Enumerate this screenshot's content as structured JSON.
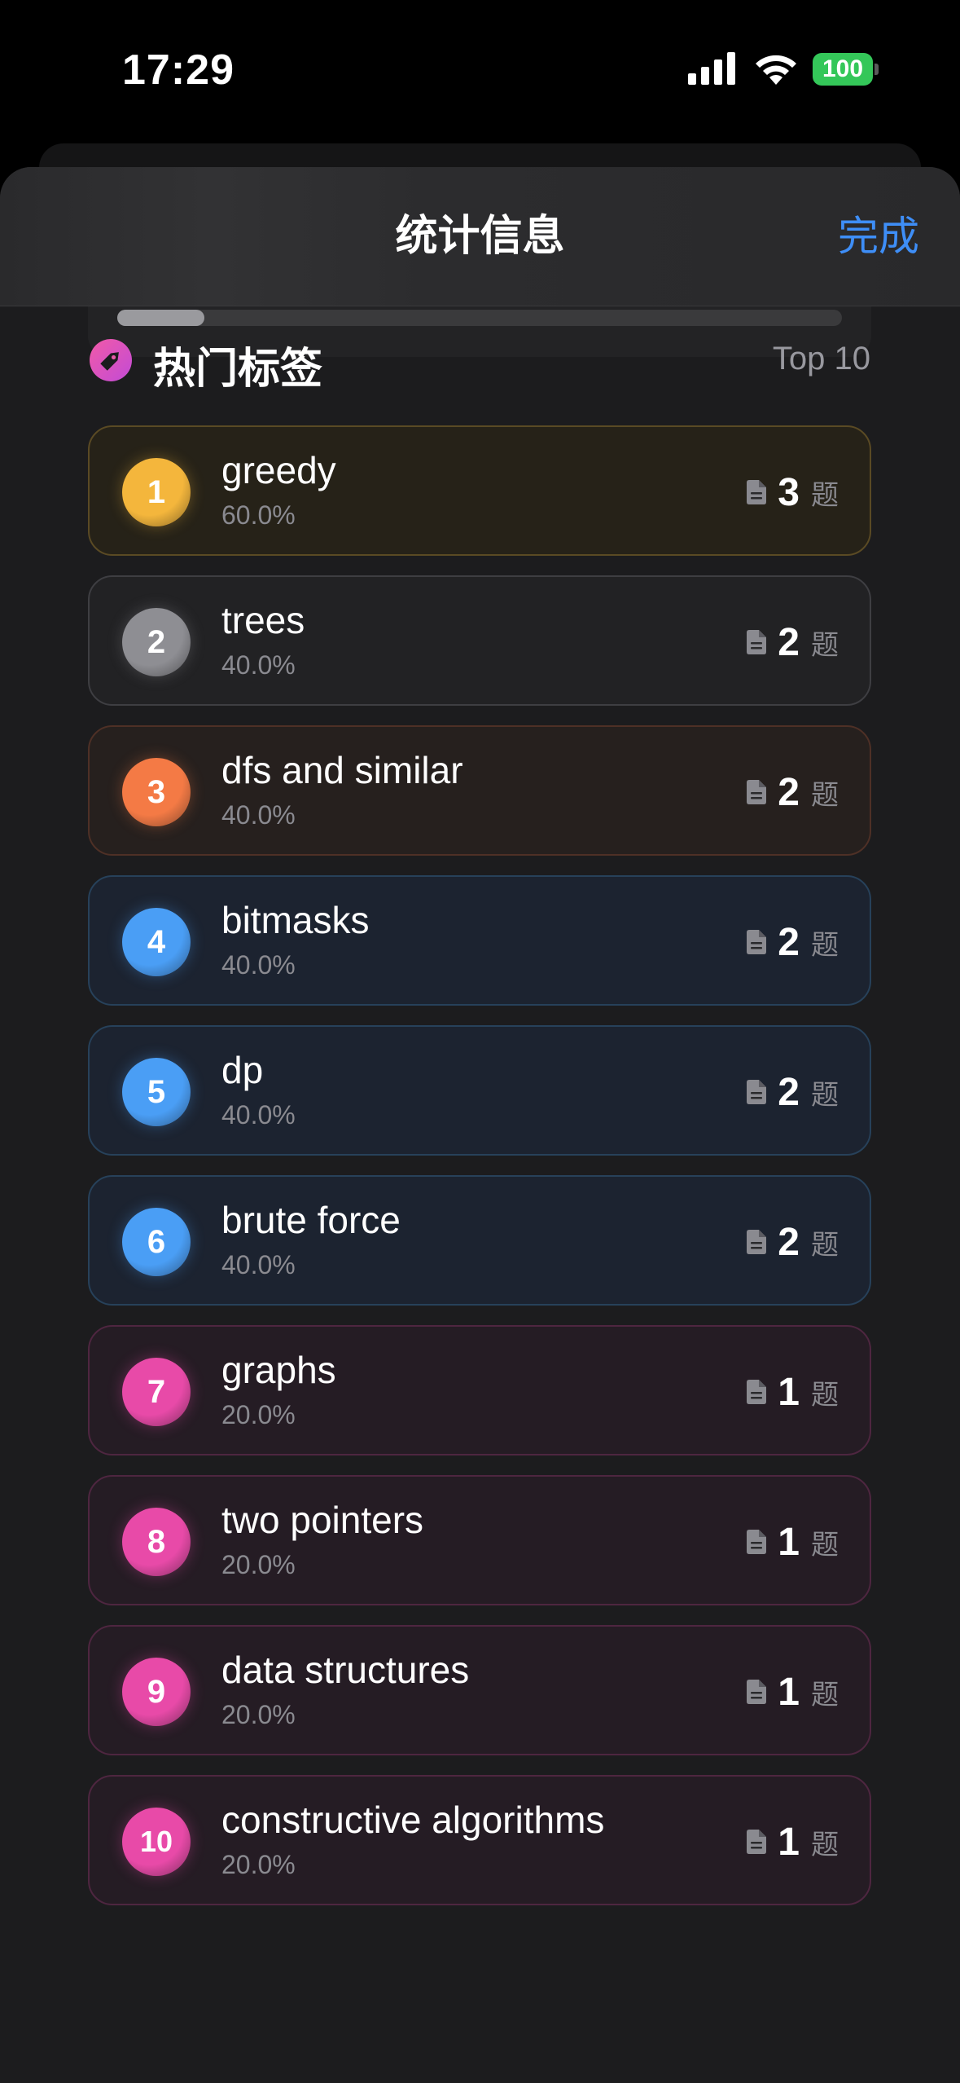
{
  "status_bar": {
    "time": "17:29",
    "battery": "100"
  },
  "nav": {
    "title": "统计信息",
    "done_label": "完成"
  },
  "progress": {
    "fraction": 0.12
  },
  "section": {
    "title": "热门标签",
    "top_label": "Top 10",
    "icon": "tag-icon"
  },
  "count_unit": "题",
  "tags": [
    {
      "rank": "1",
      "name": "greedy",
      "percent": "60.0%",
      "count": "3",
      "color": "#f4b63c",
      "border": "#5a4a24",
      "bg": "#262218"
    },
    {
      "rank": "2",
      "name": "trees",
      "percent": "40.0%",
      "count": "2",
      "color": "#8e8e93",
      "border": "#3e3e42",
      "bg": "#222224"
    },
    {
      "rank": "3",
      "name": "dfs and similar",
      "percent": "40.0%",
      "count": "2",
      "color": "#f47a45",
      "border": "#4e3026",
      "bg": "#26201e"
    },
    {
      "rank": "4",
      "name": "bitmasks",
      "percent": "40.0%",
      "count": "2",
      "color": "#4a9ef5",
      "border": "#27415a",
      "bg": "#1c2330"
    },
    {
      "rank": "5",
      "name": "dp",
      "percent": "40.0%",
      "count": "2",
      "color": "#4a9ef5",
      "border": "#27415a",
      "bg": "#1c2330"
    },
    {
      "rank": "6",
      "name": "brute force",
      "percent": "40.0%",
      "count": "2",
      "color": "#4a9ef5",
      "border": "#27415a",
      "bg": "#1c2330"
    },
    {
      "rank": "7",
      "name": "graphs",
      "percent": "20.0%",
      "count": "1",
      "color": "#e84aa8",
      "border": "#4e2640",
      "bg": "#251c24"
    },
    {
      "rank": "8",
      "name": "two pointers",
      "percent": "20.0%",
      "count": "1",
      "color": "#e84aa8",
      "border": "#4e2640",
      "bg": "#251c24"
    },
    {
      "rank": "9",
      "name": "data structures",
      "percent": "20.0%",
      "count": "1",
      "color": "#e84aa8",
      "border": "#4e2640",
      "bg": "#251c24"
    },
    {
      "rank": "10",
      "name": "constructive algorithms",
      "percent": "20.0%",
      "count": "1",
      "color": "#e84aa8",
      "border": "#4e2640",
      "bg": "#251c24"
    }
  ]
}
